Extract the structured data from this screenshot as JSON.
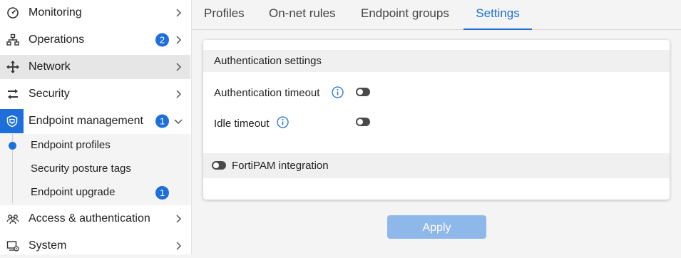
{
  "sidebar": {
    "items": [
      {
        "label": "Monitoring",
        "icon": "gauge-icon"
      },
      {
        "label": "Operations",
        "icon": "network-tree-icon",
        "badge": "2"
      },
      {
        "label": "Network",
        "icon": "move-arrows-icon"
      },
      {
        "label": "Security",
        "icon": "swap-arrows-icon"
      },
      {
        "label": "Endpoint management",
        "icon": "endpoint-icon",
        "badge": "1"
      },
      {
        "label": "Access & authentication",
        "icon": "users-icon"
      },
      {
        "label": "System",
        "icon": "system-icon"
      }
    ],
    "submenu": [
      {
        "label": "Endpoint profiles"
      },
      {
        "label": "Security posture tags"
      },
      {
        "label": "Endpoint upgrade",
        "badge": "1"
      }
    ]
  },
  "tabs": [
    {
      "label": "Profiles"
    },
    {
      "label": "On-net rules"
    },
    {
      "label": "Endpoint groups"
    },
    {
      "label": "Settings"
    }
  ],
  "settings": {
    "section_title": "Authentication settings",
    "auth_timeout_label": "Authentication timeout",
    "idle_timeout_label": "Idle timeout",
    "fortipam_label": "FortiPAM integration",
    "apply_label": "Apply"
  },
  "colors": {
    "accent": "#1e6fd9",
    "apply_disabled": "#8fb8ea"
  }
}
